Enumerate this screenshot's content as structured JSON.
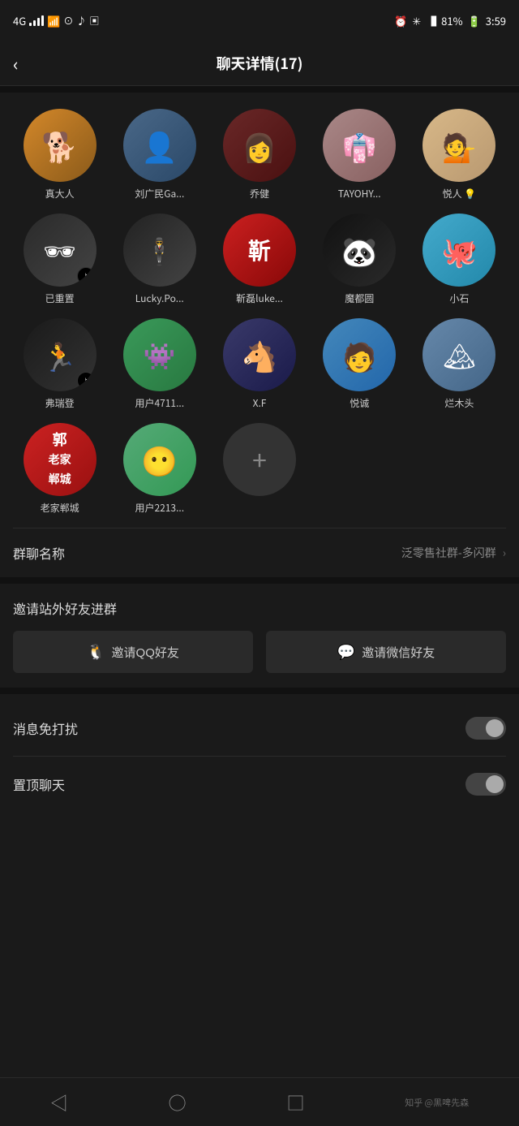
{
  "status_bar": {
    "signal": "4G",
    "wifi_icon": "wifi",
    "time": "3:59",
    "battery_percent": "81%",
    "icons": [
      "alarm",
      "bluetooth",
      "signal",
      "battery"
    ]
  },
  "header": {
    "back_label": "‹",
    "title": "聊天详情(17)"
  },
  "members": [
    {
      "id": 1,
      "name": "真大人",
      "avatar_class": "av-zhendaren",
      "avatar_text": "🐕",
      "has_tiktok": false
    },
    {
      "id": 2,
      "name": "刘广民Ga...",
      "avatar_class": "av-liuguanmin",
      "avatar_text": "👤",
      "has_tiktok": false
    },
    {
      "id": 3,
      "name": "乔健",
      "avatar_class": "av-qiaojian",
      "avatar_text": "👩",
      "has_tiktok": false
    },
    {
      "id": 4,
      "name": "TAYOHY...",
      "avatar_class": "av-tayohy",
      "avatar_text": "👗",
      "has_tiktok": false
    },
    {
      "id": 5,
      "name": "悦人 💡",
      "avatar_class": "av-yueren",
      "avatar_text": "💁",
      "has_tiktok": false
    },
    {
      "id": 6,
      "name": "已重置",
      "avatar_class": "av-yizhongzhi",
      "avatar_text": "👓",
      "has_tiktok": true
    },
    {
      "id": 7,
      "name": "Lucky.Po...",
      "avatar_class": "av-luckypo",
      "avatar_text": "🕴",
      "has_tiktok": false
    },
    {
      "id": 8,
      "name": "靳磊luke...",
      "avatar_class": "av-xinluke",
      "avatar_text": "靳",
      "has_tiktok": false
    },
    {
      "id": 9,
      "name": "魔都圆",
      "avatar_class": "av-moduyuan",
      "avatar_text": "🐼",
      "has_tiktok": false
    },
    {
      "id": 10,
      "name": "小石",
      "avatar_class": "av-xiaoshi",
      "avatar_text": "🐙",
      "has_tiktok": false
    },
    {
      "id": 11,
      "name": "弗瑞登",
      "avatar_class": "av-furuizheng",
      "avatar_text": "🏃",
      "has_tiktok": true
    },
    {
      "id": 12,
      "name": "用户4711...",
      "avatar_class": "av-yonghu4711",
      "avatar_text": "👾",
      "has_tiktok": false
    },
    {
      "id": 13,
      "name": "X.F",
      "avatar_class": "av-xf",
      "avatar_text": "🐴",
      "has_tiktok": false
    },
    {
      "id": 14,
      "name": "悦诚",
      "avatar_class": "av-yuecheng",
      "avatar_text": "👦",
      "has_tiktok": false
    },
    {
      "id": 15,
      "name": "烂木头",
      "avatar_class": "av-lantou",
      "avatar_text": "🏔",
      "has_tiktok": false
    },
    {
      "id": 16,
      "name": "老家郸城",
      "avatar_class": "av-laojia",
      "avatar_text": "郭",
      "has_tiktok": false
    },
    {
      "id": 17,
      "name": "用户2213...",
      "avatar_class": "av-yonghu2213",
      "avatar_text": "😶",
      "has_tiktok": false
    }
  ],
  "add_button": {
    "label": "+"
  },
  "settings": {
    "group_name_label": "群聊名称",
    "group_name_value": "泛零售社群-多闪群",
    "invite_title": "邀请站外好友进群",
    "invite_qq_label": "邀请QQ好友",
    "invite_wechat_label": "邀请微信好友",
    "mute_label": "消息免打扰",
    "mute_on": false,
    "pin_label": "置顶聊天",
    "pin_on": false
  },
  "bottom_nav": {
    "back_icon": "◁",
    "home_icon": "○",
    "recent_icon": "□",
    "source_text": "知乎 @黑啤先森"
  }
}
